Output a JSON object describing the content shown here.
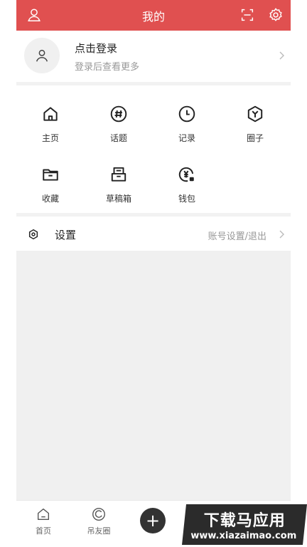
{
  "header": {
    "title": "我的",
    "left_icon": "user-icon",
    "right_icons": [
      "scan-icon",
      "gear-icon"
    ],
    "bg_color": "#e05050"
  },
  "profile": {
    "title": "点击登录",
    "subtitle": "登录后查看更多",
    "avatar_icon": "person-icon"
  },
  "grid": [
    {
      "label": "主页",
      "icon": "home-icon"
    },
    {
      "label": "话题",
      "icon": "hashtag-icon"
    },
    {
      "label": "记录",
      "icon": "clock-icon"
    },
    {
      "label": "圈子",
      "icon": "cube-icon"
    },
    {
      "label": "收藏",
      "icon": "folder-icon"
    },
    {
      "label": "草稿箱",
      "icon": "drafts-icon"
    },
    {
      "label": "钱包",
      "icon": "wallet-icon"
    }
  ],
  "settings": {
    "title": "设置",
    "hint": "账号设置/退出",
    "icon": "settings-icon"
  },
  "tabbar": {
    "tabs": [
      {
        "label": "首页",
        "icon": "home-tab-icon"
      },
      {
        "label": "吊友圈",
        "icon": "circle-tab-icon"
      }
    ],
    "plus_label": "+"
  },
  "watermark": {
    "line1": "下载马应用",
    "line2": "www.xiazaimao.com"
  }
}
